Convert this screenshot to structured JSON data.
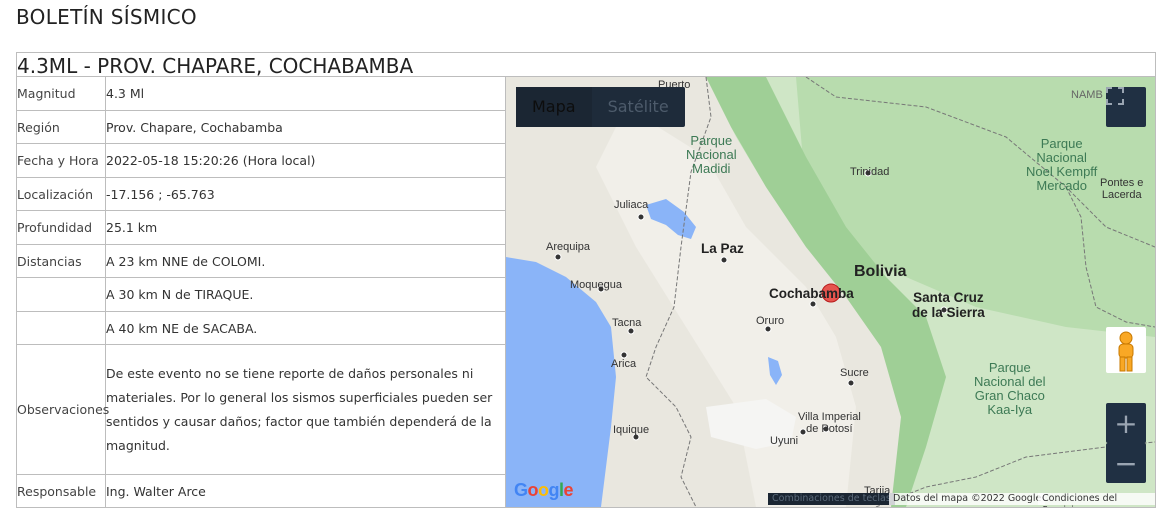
{
  "page": {
    "title": "BOLETÍN SÍSMICO"
  },
  "event": {
    "title": "4.3ML - PROV. CHAPARE, COCHABAMBA"
  },
  "info_rows": [
    {
      "key": "Magnitud",
      "value": "4.3 Ml"
    },
    {
      "key": "Región",
      "value": "Prov. Chapare, Cochabamba"
    },
    {
      "key": "Fecha y Hora",
      "value": "2022-05-18 15:20:26 (Hora local)"
    },
    {
      "key": "Localización",
      "value": "-17.156 ; -65.763"
    },
    {
      "key": "Profundidad",
      "value": "25.1 km"
    },
    {
      "key": "Distancias",
      "value": "A 23 km NNE de COLOMI."
    },
    {
      "key": "",
      "value": "A 30 km N de TIRAQUE."
    },
    {
      "key": "",
      "value": "A 40 km NE de SACABA."
    },
    {
      "key": "Observaciones",
      "value": "De este evento no se tiene reporte de daños personales ni materiales. Por lo general los sismos superficiales pueden ser sentidos y causar daños; factor que también dependerá de la magnitud."
    },
    {
      "key": "Responsable",
      "value": "Ing. Walter Arce"
    }
  ],
  "map": {
    "type_map": "Mapa",
    "type_satellite": "Satélite",
    "logo": "Google",
    "attr_shortcuts": "Combinaciones de teclas",
    "attr_data": "Datos del mapa ©2022 Google",
    "attr_terms": "Condiciones del Servicio",
    "zoom_in": "+",
    "zoom_out": "−",
    "labels": {
      "puerto": "Puerto",
      "madidi_1": "Parque",
      "madidi_2": "Nacional",
      "madidi_3": "Madidi",
      "trinidad": "Trinidad",
      "kempff_1": "Parque",
      "kempff_2": "Nacional",
      "kempff_3": "Noel Kempff",
      "kempff_4": "Mercado",
      "pontes_1": "Pontes e",
      "pontes_2": "Lacerda",
      "namb": "NAMB",
      "juliaca": "Juliaca",
      "arequipa": "Arequipa",
      "lapaz": "La Paz",
      "bolivia": "Bolivia",
      "moquegua": "Moquegua",
      "cochabamba": "Cochabamba",
      "santacruz_1": "Santa Cruz",
      "santacruz_2": "de la Sierra",
      "tacna": "Tacna",
      "oruro": "Oruro",
      "arica": "Arica",
      "sucre": "Sucre",
      "chaco_1": "Parque",
      "chaco_2": "Nacional del",
      "chaco_3": "Gran Chaco",
      "chaco_4": "Kaa-Iya",
      "iquique": "Iquique",
      "villa_1": "Villa Imperial",
      "villa_2": "de Potosí",
      "uyuni": "Uyuni",
      "tarija": "Tarija"
    }
  },
  "colors": {
    "marker": "#e53935",
    "ocean": "#8ab4f8",
    "forest": "#a8d5a2",
    "arid": "#e9e7e0",
    "controls": "#203043"
  }
}
